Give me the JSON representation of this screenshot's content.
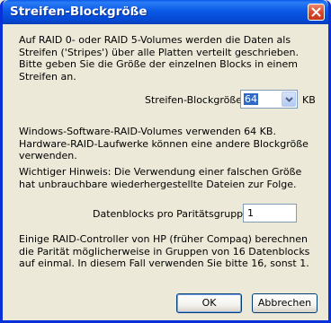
{
  "window": {
    "title": "Streifen-Blockgröße"
  },
  "content": {
    "intro": "Auf RAID 0- oder RAID 5-Volumes werden die Daten als Streifen ('Stripes') über alle Platten verteilt geschrieben. Bitte geben Sie die Größe der einzelnen Blocks in einem Streifen an.",
    "stripe_label": "Streifen-Blockgröße:",
    "stripe_value": "64",
    "stripe_unit": "KB",
    "software_note": "Windows-Software-RAID-Volumes verwenden 64 KB. Hardware-RAID-Laufwerke können eine andere Blockgröße verwenden.",
    "warning": "Wichtiger Hinweis: Die Verwendung einer falschen Größe hat unbrauchbare wiederhergestellte Dateien zur Folge.",
    "group_label": "Datenblocks pro Paritätsgruppe:",
    "group_value": "1",
    "hp_note": "Einige RAID-Controller von HP (früher Compaq) berechnen die Parität möglicherweise in Gruppen von 16 Datenblocks auf einmal. In diesem Fall verwenden Sie bitte 16, sonst 1."
  },
  "buttons": {
    "ok": "OK",
    "cancel": "Abbrechen"
  },
  "icons": {
    "close": "close-icon",
    "dropdown": "chevron-down-icon"
  }
}
